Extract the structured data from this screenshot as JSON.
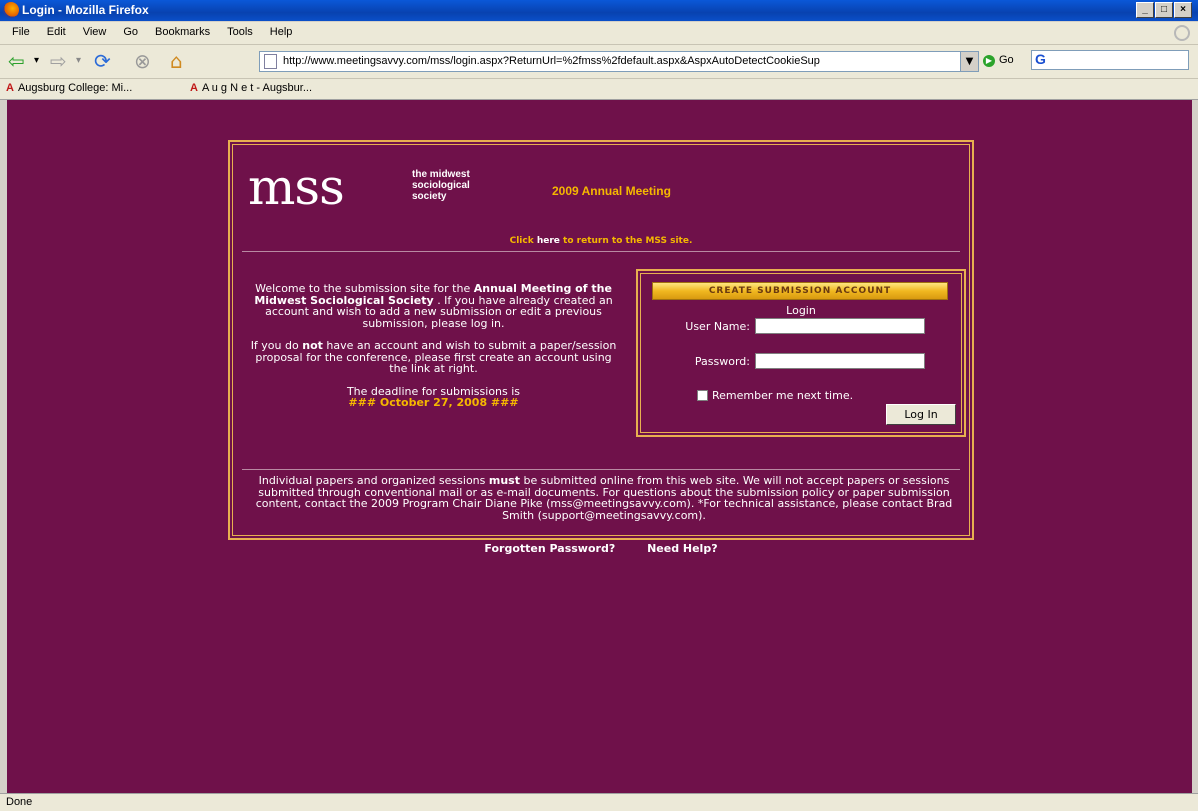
{
  "window": {
    "title": "Login - Mozilla Firefox",
    "controls": [
      "_",
      "□",
      "×"
    ]
  },
  "menu": [
    "File",
    "Edit",
    "View",
    "Go",
    "Bookmarks",
    "Tools",
    "Help"
  ],
  "nav": {
    "url": "http://www.meetingsavvy.com/mss/login.aspx?ReturnUrl=%2fmss%2fdefault.aspx&AspxAutoDetectCookieSup",
    "go_label": "Go",
    "search_value": "G"
  },
  "bookmarks": [
    "Augsburg College: Mi...",
    "A u g N e t - Augsbur..."
  ],
  "page": {
    "logo": "mss",
    "logo_sub": [
      "the midwest",
      "sociological",
      "society"
    ],
    "annual_meeting": "2009 Annual Meeting",
    "click_prefix": "Click",
    "click_link": "here",
    "click_suffix": "to return to the MSS site.",
    "welcome_1a": "Welcome to the submission site for the",
    "welcome_1b": "Annual Meeting of the Midwest Sociological Society",
    "welcome_1c": ". If you have already created an account and wish to add a new submission or edit a previous submission, please log in.",
    "welcome_2a": "If you do",
    "welcome_2b": "not",
    "welcome_2c": "have an account and wish to submit a paper/session proposal for the conference, please first create an account using the link at right.",
    "deadline_label": "The deadline for submissions is",
    "deadline_value": "### October 27, 2008 ###",
    "create_account": "CREATE SUBMISSION ACCOUNT",
    "login_title": "Login",
    "username_label": "User Name:",
    "password_label": "Password:",
    "remember": "Remember me next time.",
    "login_button": "Log In",
    "notice_a": "Individual papers and organized sessions",
    "notice_b": "must",
    "notice_c": "be submitted online from this web site. We will not accept papers or sessions submitted through conventional mail or as e-mail documents. For questions about the submission policy or paper submission content, contact the 2009 Program Chair Diane Pike (mss@meetingsavvy.com). *For technical assistance, please contact Brad Smith (support@meetingsavvy.com).",
    "forgot": "Forgotten Password?",
    "help": "Need Help?"
  },
  "status": "Done",
  "colors": {
    "background": "#6f114a",
    "accent": "#f5b800",
    "border": "#e8b050"
  }
}
